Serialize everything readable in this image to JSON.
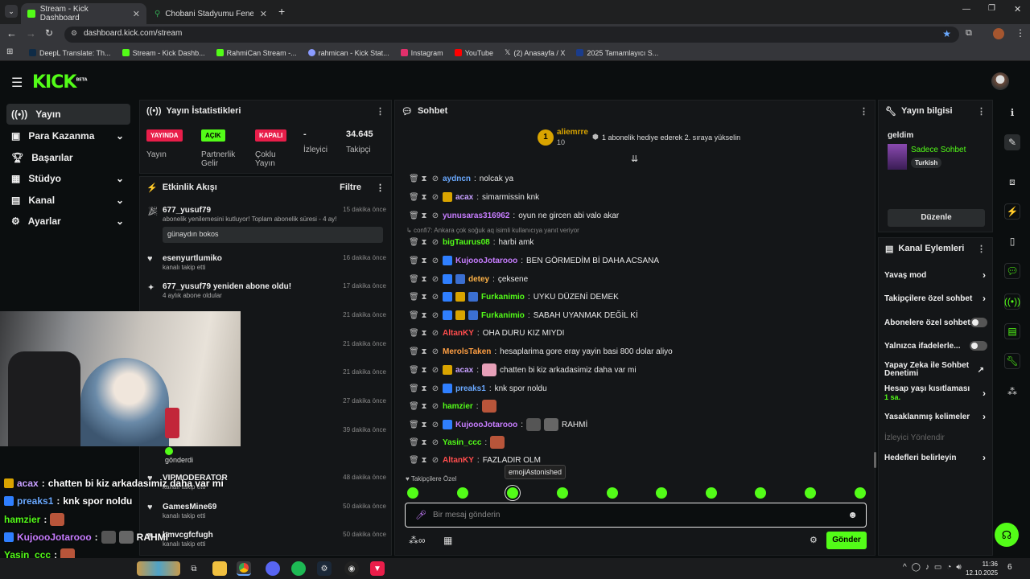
{
  "browser": {
    "tabs": [
      {
        "title": "Stream - Kick Dashboard",
        "active": true
      },
      {
        "title": "Chobani Stadyumu Fenerbahçe",
        "active": false
      }
    ],
    "url": "dashboard.kick.com/stream",
    "bookmarks": [
      "DeepL Translate: Th...",
      "Stream - Kick Dashb...",
      "RahmiCan Stream -...",
      "rahmican - Kick Stat...",
      "Instagram",
      "YouTube",
      "(2) Anasayfa / X",
      "2025 Tamamlayıcı S..."
    ]
  },
  "brand": {
    "logo": "KICK",
    "beta": "BETA",
    "accent": "#53fc18"
  },
  "sidebar": {
    "items": [
      {
        "label": "Yayın",
        "selected": true,
        "expand": false
      },
      {
        "label": "Para Kazanma",
        "selected": false,
        "expand": true
      },
      {
        "label": "Başarılar",
        "selected": false,
        "expand": false
      },
      {
        "label": "Stüdyo",
        "selected": false,
        "expand": true
      },
      {
        "label": "Kanal",
        "selected": false,
        "expand": true
      },
      {
        "label": "Ayarlar",
        "selected": false,
        "expand": true
      }
    ]
  },
  "stats": {
    "title": "Yayın İstatistikleri",
    "items": [
      {
        "badge": "YAYINDA",
        "label": "Yayın",
        "color": "#e91e4a"
      },
      {
        "badge": "AÇIK",
        "label": "Partnerlik Gelir",
        "color": "#53fc18"
      },
      {
        "badge": "KAPALI",
        "label": "Çoklu Yayın",
        "color": "#e91e4a"
      },
      {
        "value": "-",
        "label": "İzleyici"
      },
      {
        "value": "34.645",
        "label": "Takipçi"
      }
    ]
  },
  "activity": {
    "title": "Etkinlik Akışı",
    "filter": "Filtre",
    "items": [
      {
        "name": "677_yusuf79",
        "sub": "abonelik yenilemesini kutluyor! Toplam abonelik süresi - 4 ay!",
        "time": "15 dakika önce",
        "msg": "günaydın bokos"
      },
      {
        "name": "esenyurtlumiko",
        "sub": "kanalı takip etti",
        "time": "16 dakika önce"
      },
      {
        "name": "677_yusuf79 yeniden abone oldu!",
        "sub": "4 aylık abone oldular",
        "time": "17 dakika önce"
      },
      {
        "time": "21 dakika önce"
      },
      {
        "time": "21 dakika önce"
      },
      {
        "time": "21 dakika önce"
      },
      {
        "time": "27 dakika önce"
      },
      {
        "time": "39 dakika önce",
        "sub": "gönderdi"
      },
      {
        "name": "VIPMODERATOR",
        "sub": "kanalı takip etti",
        "time": "48 dakika önce"
      },
      {
        "name": "GamesMine69",
        "sub": "kanalı takip etti",
        "time": "50 dakika önce"
      },
      {
        "name": "bmvcgfcfugh",
        "sub": "kanalı takip etti",
        "time": "50 dakika önce"
      }
    ]
  },
  "chat": {
    "title": "Sohbet",
    "pinned": {
      "user": "aliemrre",
      "count": "10",
      "rank": "1",
      "text": "1 abonelik hediye ederek 2. sıraya yükselin"
    },
    "reply_note": "confi7: Ankara çok soğuk aq isimli kullanıcıya yanıt veriyor",
    "messages": [
      {
        "user": "aydncn",
        "text": "nolcak ya",
        "color": "#6aa9ff"
      },
      {
        "user": "acax",
        "text": "simarmissin knk",
        "color": "#c7a0ff"
      },
      {
        "user": "yunusaras316962",
        "text": "oyun ne gircen abi valo akar",
        "color": "#c77dff"
      },
      {
        "user": "bigTaurus08",
        "text": "harbi amk",
        "color": "#53fc18"
      },
      {
        "user": "KujoooJotarooo",
        "text": "BEN GÖRMEDİM Bİ DAHA ACSANA",
        "color": "#c77dff"
      },
      {
        "user": "detey",
        "text": "çeksene",
        "color": "#ffb347"
      },
      {
        "user": "Furkanimio",
        "text": "UYKU DÜZENİ DEMEK",
        "color": "#53fc18"
      },
      {
        "user": "Furkanimio",
        "text": "SABAH UYANMAK DEĞİL Kİ",
        "color": "#53fc18"
      },
      {
        "user": "AltanKY",
        "text": "OHA DURU KIZ MIYDI",
        "color": "#ff4d4d"
      },
      {
        "user": "MerolsTaken",
        "text": "hesaplarima gore eray yayin basi 800 dolar aliyo",
        "color": "#ff9f43"
      },
      {
        "user": "acax",
        "text": "chatten bi kiz arkadasimiz daha var mi",
        "color": "#c7a0ff"
      },
      {
        "user": "preaks1",
        "text": "knk spor noldu",
        "color": "#6aa9ff"
      },
      {
        "user": "hamzier",
        "text": "",
        "color": "#53fc18"
      },
      {
        "user": "KujoooJotarooo",
        "text": "RAHMİ",
        "color": "#c77dff"
      },
      {
        "user": "Yasin_ccc",
        "text": "",
        "color": "#53fc18"
      },
      {
        "user": "AltanKY",
        "text": "FAZLADIR OLM",
        "color": "#ff4d4d"
      }
    ],
    "tooltip": "emojiAstonished",
    "mode_label": "Takipçilere Özel",
    "input_placeholder": "Bir mesaj gönderin",
    "send": "Gönder"
  },
  "stream_info": {
    "title": "Yayın bilgisi",
    "stream_title": "geldim",
    "category": "Sadece Sohbet",
    "language": "Turkish",
    "edit": "Düzenle"
  },
  "channel_actions": {
    "title": "Kanal Eylemleri",
    "items": [
      {
        "label": "Yavaş mod",
        "kind": "chevron"
      },
      {
        "label": "Takipçilere özel sohbet",
        "kind": "chevron"
      },
      {
        "label": "Abonelere özel sohbet",
        "kind": "toggle"
      },
      {
        "label": "Yalnızca ifadelerle...",
        "kind": "toggle"
      },
      {
        "label": "Yapay Zeka ile Sohbet Denetimi",
        "kind": "external"
      },
      {
        "label": "Hesap yaşı kısıtlaması",
        "sub": "1 sa.",
        "kind": "chevron"
      },
      {
        "label": "Yasaklanmış kelimeler",
        "kind": "chevron"
      },
      {
        "label": "İzleyici Yönlendir",
        "kind": "disabled"
      },
      {
        "label": "Hedefleri belirleyin",
        "kind": "chevron"
      }
    ]
  },
  "overlay_chat": [
    {
      "user": "acax",
      "text": "chatten bi kiz arkadasimiz daha var mi",
      "color": "#c7a0ff"
    },
    {
      "user": "preaks1",
      "text": "knk spor noldu",
      "color": "#6aa9ff"
    },
    {
      "user": "hamzier",
      "text": "",
      "color": "#53fc18"
    },
    {
      "user": "KujoooJotarooo",
      "text": "RAHMİ",
      "color": "#c77dff"
    },
    {
      "user": "Yasin_ccc",
      "text": "",
      "color": "#53fc18"
    },
    {
      "user": "AltanKY",
      "text": "FAZLADIR OLM",
      "color": "#ff4d4d"
    }
  ],
  "taskbar": {
    "time": "11:36",
    "date": "12.10.2025",
    "notifications": "6"
  }
}
